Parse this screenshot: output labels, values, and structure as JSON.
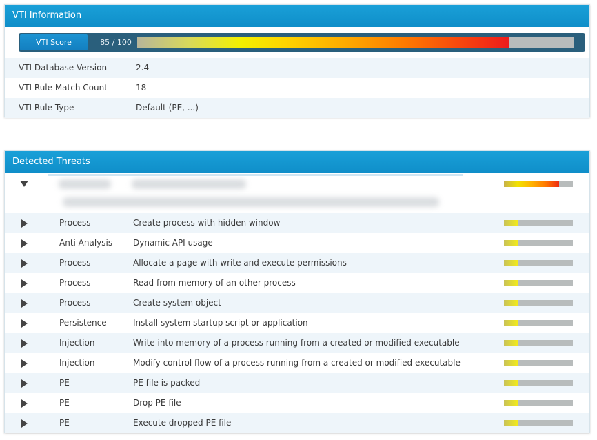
{
  "vti_panel": {
    "title": "VTI Information",
    "score_label": "VTI Score",
    "score_text": "85 / 100",
    "score_fraction": 0.85,
    "rows": [
      {
        "key": "VTI Database Version",
        "value": "2.4"
      },
      {
        "key": "VTI Rule Match Count",
        "value": "18"
      },
      {
        "key": "VTI Rule Type",
        "value": "Default (PE, ...)"
      }
    ]
  },
  "threats_panel": {
    "title": "Detected Threats",
    "expanded_score_fraction": 0.8,
    "threats": [
      {
        "category": "Process",
        "description": "Create process with hidden window",
        "score_fraction": 0.2
      },
      {
        "category": "Anti Analysis",
        "description": "Dynamic API usage",
        "score_fraction": 0.2
      },
      {
        "category": "Process",
        "description": "Allocate a page with write and execute permissions",
        "score_fraction": 0.2
      },
      {
        "category": "Process",
        "description": "Read from memory of an other process",
        "score_fraction": 0.2
      },
      {
        "category": "Process",
        "description": "Create system object",
        "score_fraction": 0.2
      },
      {
        "category": "Persistence",
        "description": "Install system startup script or application",
        "score_fraction": 0.2
      },
      {
        "category": "Injection",
        "description": "Write into memory of a process running from a created or modified executable",
        "score_fraction": 0.2
      },
      {
        "category": "Injection",
        "description": "Modify control flow of a process running from a created or modified executable",
        "score_fraction": 0.2
      },
      {
        "category": "PE",
        "description": "PE file is packed",
        "score_fraction": 0.2
      },
      {
        "category": "PE",
        "description": "Drop PE file",
        "score_fraction": 0.2
      },
      {
        "category": "PE",
        "description": "Execute dropped PE file",
        "score_fraction": 0.2
      }
    ]
  },
  "colors": {
    "header_blue": "#1aa0d8",
    "score_bar_bg": "#2a5f7c",
    "track_gray": "#b8bcbc",
    "row_alt": "#eef5fa"
  },
  "icons": {
    "collapse": "triangle-down-icon",
    "expand": "triangle-right-icon"
  }
}
